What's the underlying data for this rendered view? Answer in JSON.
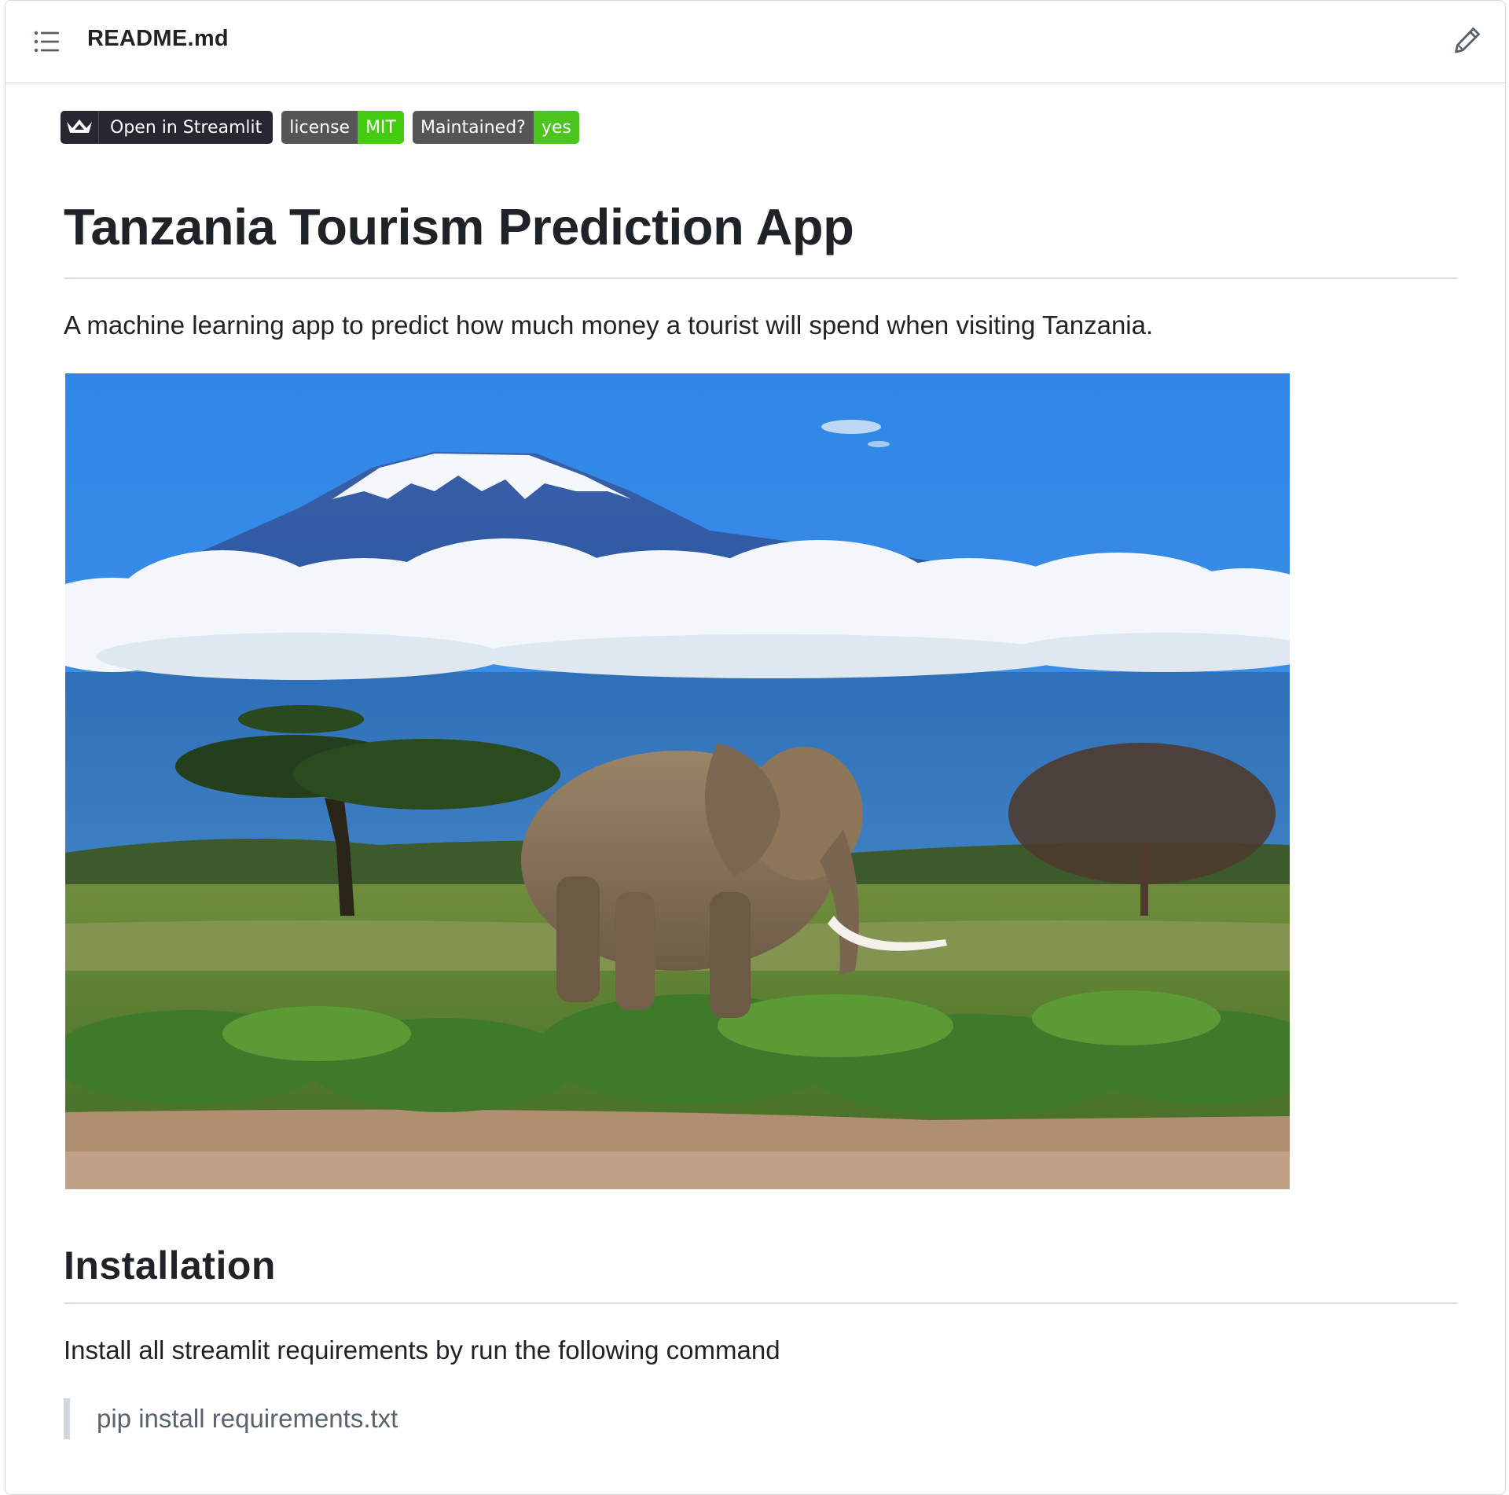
{
  "header": {
    "file_name": "README.md",
    "toc_icon": "list-unordered-icon",
    "edit_icon": "pencil-icon"
  },
  "badges": {
    "streamlit": {
      "icon": "streamlit-crown-icon",
      "label": "Open in Streamlit"
    },
    "license": {
      "label": "license",
      "value": "MIT",
      "value_color": "#44cc11"
    },
    "maintained": {
      "label": "Maintained?",
      "value": "yes",
      "value_color": "#4cc61e"
    }
  },
  "readme": {
    "title": "Tanzania Tourism Prediction App",
    "description": "A machine learning app to predict how much money a tourist will spend when visiting Tanzania.",
    "installation_heading": "Installation",
    "installation_text": "Install all streamlit requirements by run the following command",
    "command": "pip install requirements.txt"
  }
}
